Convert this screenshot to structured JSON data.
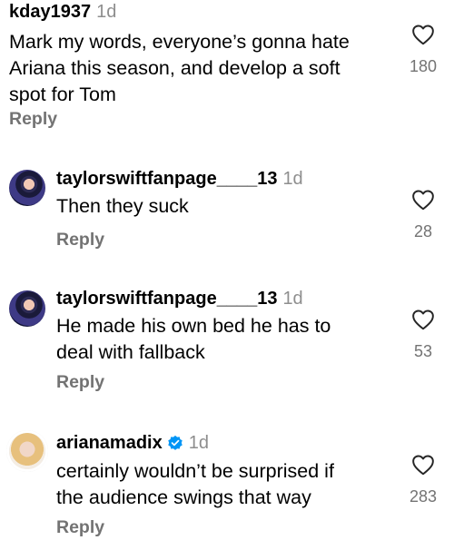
{
  "comments": [
    {
      "username": "kday1937",
      "time": "1d",
      "text_lines": [
        "Mark my words, everyone’s gonna hate",
        "Ariana this season, and develop a soft",
        "spot for Tom"
      ],
      "reply_label": "Reply",
      "likes": "180"
    },
    {
      "username": "taylorswiftfanpage____13",
      "time": "1d",
      "text_lines": [
        "Then they suck"
      ],
      "reply_label": "Reply",
      "likes": "28"
    },
    {
      "username": "taylorswiftfanpage____13",
      "time": "1d",
      "text_lines": [
        "He made his own bed he has to",
        "deal with fallback"
      ],
      "reply_label": "Reply",
      "likes": "53"
    },
    {
      "username": "arianamadix",
      "time": "1d",
      "verified": true,
      "text_lines": [
        "certainly wouldn’t be surprised if",
        "the audience swings that way"
      ],
      "reply_label": "Reply",
      "likes": "283"
    }
  ],
  "icons": {
    "like": "heart-outline-icon",
    "verified": "verified-badge-icon"
  },
  "colors": {
    "secondary_text": "#737373",
    "verified_blue": "#0095f6"
  }
}
